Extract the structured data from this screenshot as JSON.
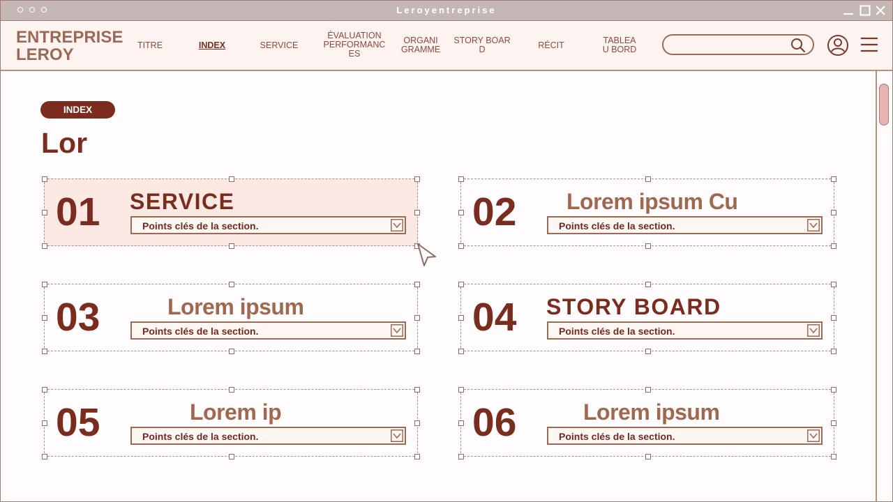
{
  "window": {
    "title": "Leroyentreprise"
  },
  "nav": {
    "brand_line1": "ENTREPRISE",
    "brand_line2": "LEROY",
    "items": [
      {
        "label": "TITRE"
      },
      {
        "label": "INDEX"
      },
      {
        "label": "SERVICE"
      },
      {
        "label": "ÉVALUATION\nPERFORMANC\nES"
      },
      {
        "label": "ORGANI\nGRAMME"
      },
      {
        "label": "STORY BOAR\nD"
      },
      {
        "label": "RÉCIT"
      },
      {
        "label": "TABLEA\nU BORD"
      }
    ],
    "active": "INDEX",
    "search_placeholder": ""
  },
  "page": {
    "badge": "INDEX",
    "title": "Lor"
  },
  "cards": [
    {
      "number": "01",
      "title": "SERVICE",
      "dropdown": "Points clés de la section.",
      "selected": true
    },
    {
      "number": "02",
      "title": "Lorem ipsum Cu",
      "dropdown": "Points clés de la section.",
      "selected": false
    },
    {
      "number": "03",
      "title": "Lorem ipsum",
      "dropdown": "Points clés de la section.",
      "selected": false
    },
    {
      "number": "04",
      "title": "STORY BOARD",
      "dropdown": "Points clés de la section.",
      "selected": false
    },
    {
      "number": "05",
      "title": "Lorem ip",
      "dropdown": "Points clés de la section.",
      "selected": false
    },
    {
      "number": "06",
      "title": "Lorem ipsum",
      "dropdown": "Points clés de la section.",
      "selected": false
    }
  ],
  "icons": {
    "window_dots": "dot-icon",
    "minimize": "minimize-icon",
    "maximize": "maximize-icon",
    "close": "close-icon",
    "search": "search-icon",
    "user": "user-icon",
    "menu": "hamburger-menu-icon",
    "dropdown": "chevron-down-icon",
    "cursor": "cursor-arrow-icon"
  },
  "colors": {
    "primary": "#7a2c1e",
    "accent_light": "#a0694f",
    "selected_bg": "#fde9e3",
    "titlebar": "#c4b7b6",
    "scroll_thumb": "#e8b3b5"
  }
}
